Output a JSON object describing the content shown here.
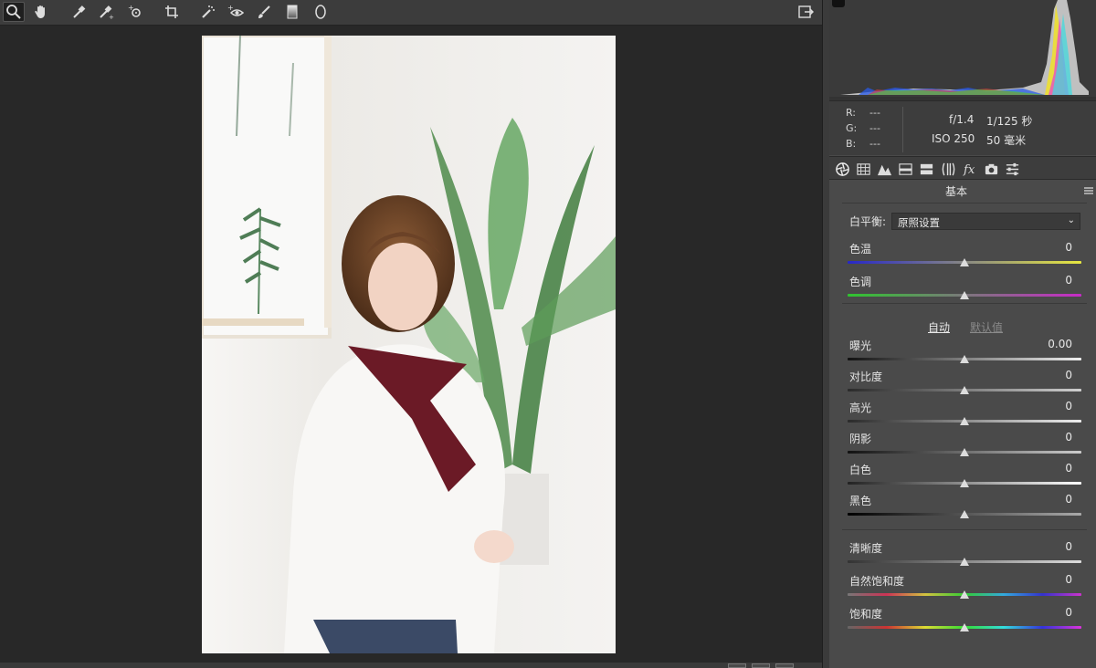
{
  "toolbar": {
    "tools": [
      {
        "icon": "zoom-icon"
      },
      {
        "icon": "hand-icon"
      },
      {
        "icon": "white-balance-icon"
      },
      {
        "icon": "color-sampler-icon"
      },
      {
        "icon": "targeted-adjustment-icon"
      },
      {
        "icon": "crop-icon"
      },
      {
        "icon": "spot-removal-icon"
      },
      {
        "icon": "red-eye-icon"
      },
      {
        "icon": "adjustment-brush-icon"
      },
      {
        "icon": "graduated-filter-icon"
      },
      {
        "icon": "radial-filter-icon"
      }
    ],
    "export_icon": "open-preferences-icon"
  },
  "info": {
    "r_label": "R:",
    "r_value": "---",
    "g_label": "G:",
    "g_value": "---",
    "b_label": "B:",
    "b_value": "---",
    "aperture": "f/1.4",
    "shutter": "1/125 秒",
    "iso": "ISO 250",
    "focal": "50 毫米"
  },
  "panel": {
    "title": "基本",
    "wb_label": "白平衡:",
    "wb_value": "原照设置",
    "auto": "自动",
    "default": "默认值",
    "sliders": [
      {
        "label": "色温",
        "value": "0",
        "position": 0.5
      },
      {
        "label": "色调",
        "value": "0",
        "position": 0.5
      },
      {
        "label": "曝光",
        "value": "0.00",
        "position": 0.5
      },
      {
        "label": "对比度",
        "value": "0",
        "position": 0.5
      },
      {
        "label": "高光",
        "value": "0",
        "position": 0.5
      },
      {
        "label": "阴影",
        "value": "0",
        "position": 0.5
      },
      {
        "label": "白色",
        "value": "0",
        "position": 0.5
      },
      {
        "label": "黑色",
        "value": "0",
        "position": 0.5
      },
      {
        "label": "清晰度",
        "value": "0",
        "position": 0.5
      },
      {
        "label": "自然饱和度",
        "value": "0",
        "position": 0.5
      },
      {
        "label": "饱和度",
        "value": "0",
        "position": 0.5
      }
    ]
  },
  "colors": {
    "temp_gradient": [
      "#2727c8",
      "#e8e840"
    ],
    "tint_gradient": [
      "#2fc42f",
      "#c72bc7"
    ],
    "accent": "#e8e8e8"
  }
}
